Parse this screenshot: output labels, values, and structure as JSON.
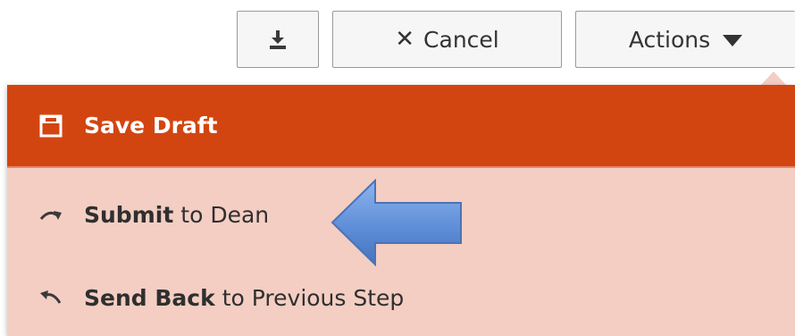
{
  "toolbar": {
    "download_icon": "download-icon",
    "cancel_label": "Cancel",
    "cancel_icon": "x",
    "actions_label": "Actions",
    "actions_icon": "caret-down-icon"
  },
  "menu": {
    "items": [
      {
        "bold": "Save Draft",
        "rest": "",
        "icon": "save-icon",
        "active": true
      },
      {
        "bold": "Submit",
        "rest": "to Dean",
        "icon": "redo-arrow-icon",
        "active": false
      },
      {
        "bold": "Send Back",
        "rest": "to Previous Step",
        "icon": "undo-arrow-icon",
        "active": false
      }
    ]
  },
  "colors": {
    "menu_active_bg": "#d34510",
    "menu_bg": "#f4cec3",
    "arrow_fill": "#5f8fd8"
  }
}
